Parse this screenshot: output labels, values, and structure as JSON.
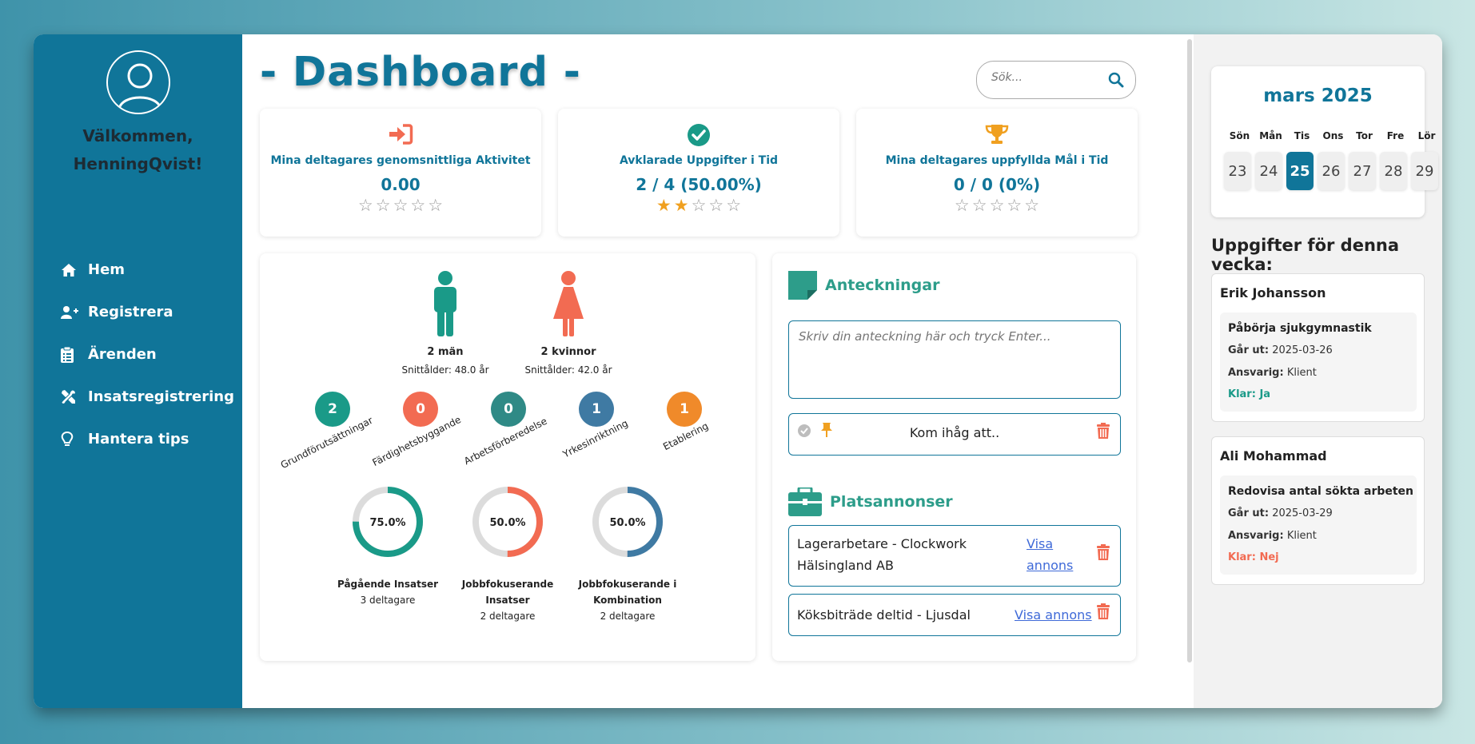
{
  "sidebar": {
    "welcome_line1": "Välkommen,",
    "welcome_line2": "HenningQvist!",
    "items": [
      {
        "label": "Hem",
        "icon": "home-icon"
      },
      {
        "label": "Registrera",
        "icon": "user-plus-icon"
      },
      {
        "label": "Ärenden",
        "icon": "clipboard-icon"
      },
      {
        "label": "Insatsregistrering",
        "icon": "tools-icon"
      },
      {
        "label": "Hantera tips",
        "icon": "lightbulb-icon"
      }
    ]
  },
  "header": {
    "title": "- Dashboard -",
    "search_placeholder": "Sök..."
  },
  "stats": [
    {
      "label": "Mina deltagares genomsnittliga Aktivitet",
      "value": "0.00",
      "stars": 0,
      "icon": "sign-in-icon",
      "color": "#f26b52"
    },
    {
      "label": "Avklarade Uppgifter i Tid",
      "value": "2 / 4 (50.00%)",
      "stars": 2,
      "icon": "check-circle-icon",
      "color": "#1a9a88"
    },
    {
      "label": "Mina deltagares uppfyllda Mål i Tid",
      "value": "0 / 0 (0%)",
      "stars": 0,
      "icon": "trophy-icon",
      "color": "#f0a020"
    }
  ],
  "gender": {
    "men_label": "2 män",
    "men_age": "Snittålder: 48.0 år",
    "women_label": "2 kvinnor",
    "women_age": "Snittålder: 42.0 år",
    "men_color": "#1a9a88",
    "women_color": "#f26b52"
  },
  "categories": [
    {
      "count": "2",
      "label": "Grundförutsättningar",
      "color": "#1a9a88"
    },
    {
      "count": "0",
      "label": "Färdighetsbyggande",
      "color": "#f26b52"
    },
    {
      "count": "0",
      "label": "Arbetsförberedelse",
      "color": "#2f8a86"
    },
    {
      "count": "1",
      "label": "Yrkesinriktning",
      "color": "#3f7aa3"
    },
    {
      "count": "1",
      "label": "Etablering",
      "color": "#f08a2a"
    }
  ],
  "donuts": [
    {
      "percent": 75.0,
      "text": "75.0%",
      "label1": "Pågående Insatser",
      "label2": "",
      "sub": "3 deltagare",
      "color": "#1a9a88"
    },
    {
      "percent": 50.0,
      "text": "50.0%",
      "label1": "Jobbfokuserande",
      "label2": "Insatser",
      "sub": "2 deltagare",
      "color": "#f26b52"
    },
    {
      "percent": 50.0,
      "text": "50.0%",
      "label1": "Jobbfokuserande i",
      "label2": "Kombination",
      "sub": "2 deltagare",
      "color": "#3f7aa3"
    }
  ],
  "notes": {
    "title": "Anteckningar",
    "placeholder": "Skriv din anteckning här och tryck Enter...",
    "items": [
      {
        "text": "Kom ihåg att.."
      }
    ]
  },
  "jobs": {
    "title": "Platsannonser",
    "items": [
      {
        "title_line1": "Lagerarbetare - Clockwork",
        "title_line2": "Hälsingland AB",
        "link_line1": "Visa",
        "link_line2": "annons"
      },
      {
        "title_line1": "Köksbiträde deltid - Ljusdal",
        "title_line2": "",
        "link_line1": "Visa annons",
        "link_line2": ""
      }
    ]
  },
  "calendar": {
    "month": "mars 2025",
    "days": [
      "Sön",
      "Mån",
      "Tis",
      "Ons",
      "Tor",
      "Fre",
      "Lör"
    ],
    "dates": [
      "23",
      "24",
      "25",
      "26",
      "27",
      "28",
      "29"
    ],
    "today": "25"
  },
  "week": {
    "title": "Uppgifter för denna vecka:",
    "tasks": [
      {
        "person": "Erik Johansson",
        "task": "Påbörja sjukgymnastik",
        "due_label": "Går ut:",
        "due": "2025-03-26",
        "resp_label": "Ansvarig:",
        "resp": "Klient",
        "done": "Klar: Ja",
        "done_color": "#1a9a88"
      },
      {
        "person": "Ali Mohammad",
        "task": "Redovisa antal sökta arbeten",
        "due_label": "Går ut:",
        "due": "2025-03-29",
        "resp_label": "Ansvarig:",
        "resp": "Klient",
        "done": "Klar: Nej",
        "done_color": "#f26b52"
      }
    ]
  },
  "colors": {
    "accent": "#107599",
    "teal": "#2d9d8a",
    "danger": "#f26b52"
  }
}
